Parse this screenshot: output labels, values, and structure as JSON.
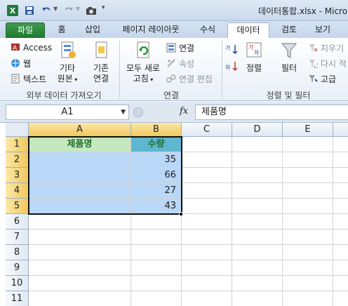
{
  "window": {
    "title": "데이터통합.xlsx  -  Micro",
    "app_icon": "X"
  },
  "qat": {
    "save_icon": "save-icon",
    "undo_icon": "undo-icon",
    "redo_icon": "redo-icon",
    "camera_icon": "camera-icon"
  },
  "tabs": [
    {
      "label": "파일"
    },
    {
      "label": "홈"
    },
    {
      "label": "삽입"
    },
    {
      "label": "페이지 레이아웃"
    },
    {
      "label": "수식"
    },
    {
      "label": "데이터"
    },
    {
      "label": "검토"
    },
    {
      "label": "보기"
    }
  ],
  "active_tab": "데이터",
  "ribbon": {
    "external": {
      "access": "Access",
      "web": "웹",
      "text": "텍스트",
      "other_line1": "기타",
      "other_line2": "원본",
      "existing_line1": "기존",
      "existing_line2": "연결",
      "label": "외부 데이터 가져오기"
    },
    "connections": {
      "refresh_line1": "모두 새로",
      "refresh_line2": "고침",
      "connect": "연결",
      "properties": "속성",
      "edit_links": "연결 편집",
      "label": "연결"
    },
    "sort_filter": {
      "sort": "정렬",
      "filter": "필터",
      "clear": "지우기",
      "reapply": "다시 적",
      "advanced": "고급",
      "label": "정렬 및 필터"
    }
  },
  "formula_bar": {
    "name_box": "A1",
    "fx": "fx",
    "content": "제품명"
  },
  "sheet": {
    "columns": [
      "A",
      "B",
      "C",
      "D",
      "E"
    ],
    "rows": [
      "1",
      "2",
      "3",
      "4",
      "5",
      "6",
      "7",
      "8",
      "9",
      "10",
      "11"
    ],
    "cells": {
      "A1": "제품명",
      "B1": "수량",
      "A2": "",
      "B2": "35",
      "A3": "",
      "B3": "66",
      "A4": "",
      "B4": "27",
      "A5": "",
      "B5": "43"
    }
  },
  "colors": {
    "header_green_fill": "#c6e8c0",
    "header_teal_fill": "#5fb6d0",
    "selection_fill": "#b9d7f6",
    "file_tab": "#2a8a3c"
  }
}
